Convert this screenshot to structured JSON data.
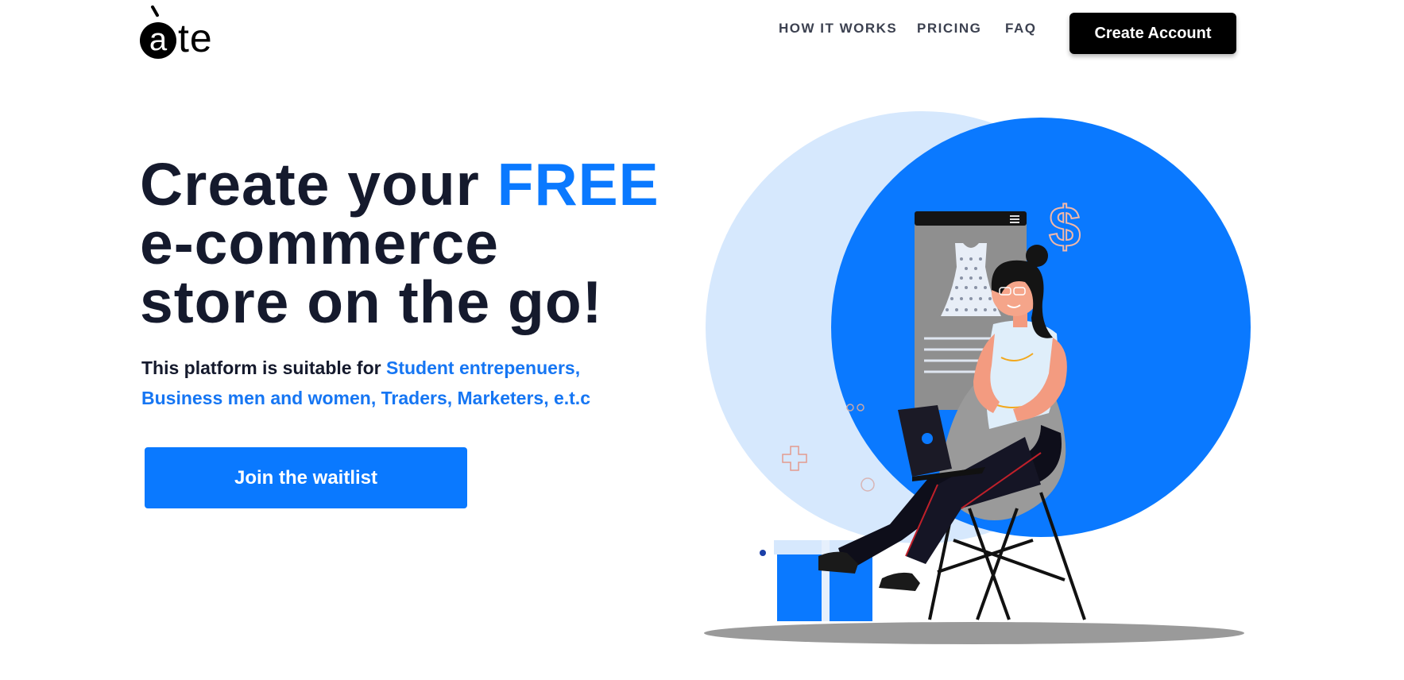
{
  "header": {
    "logo_letter": "a",
    "logo_rest": "te",
    "nav": [
      {
        "label": "HOW IT WORKS"
      },
      {
        "label": "PRICING"
      },
      {
        "label": "FAQ"
      }
    ],
    "cta_label": "Create Account"
  },
  "hero": {
    "headline_prefix": "Create your ",
    "headline_highlight": "FREE",
    "headline_line2": "e-commerce",
    "headline_line3": "store on the go!",
    "sub_prefix": "This platform is suitable for ",
    "sub_highlight_1": "Student entrepenuers,",
    "sub_highlight_2": "Business men and women, Traders, Marketers, e.t.c",
    "button_label": "Join the waitlist"
  },
  "illustration": {
    "dollar_symbol": "$"
  },
  "colors": {
    "accent": "#0a79ff",
    "text": "#151a2d",
    "button_dark": "#000000"
  }
}
